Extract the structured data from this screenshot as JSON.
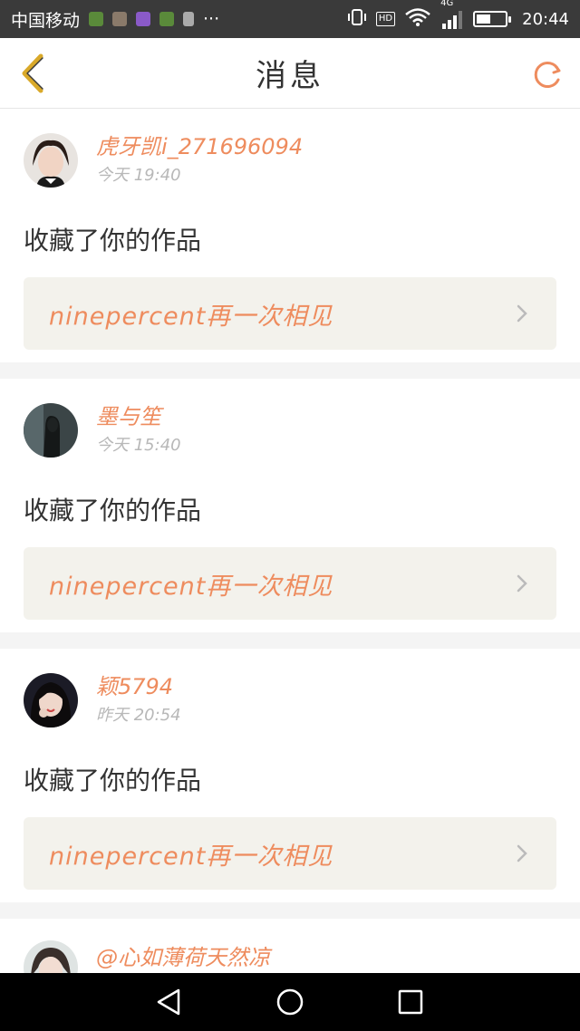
{
  "status_bar": {
    "carrier": "中国移动",
    "more": "···",
    "hd": "HD",
    "network": "4G",
    "time": "20:44",
    "battery_level": 0.5
  },
  "nav": {
    "title": "消息"
  },
  "messages": [
    {
      "username": "虎牙凯i_271696094",
      "time": "今天 19:40",
      "action": "收藏了你的作品",
      "work_title": "ninepercent再一次相见"
    },
    {
      "username": "墨与笙",
      "time": "今天 15:40",
      "action": "收藏了你的作品",
      "work_title": "ninepercent再一次相见"
    },
    {
      "username": "颖5794",
      "time": "昨天 20:54",
      "action": "收藏了你的作品",
      "work_title": "ninepercent再一次相见"
    },
    {
      "username": "@心如薄荷天然凉"
    }
  ],
  "colors": {
    "accent": "#ee8c5e",
    "status_bar": "#3a3a3a",
    "work_bg": "#f3f2ec",
    "back_icon": "#d9a92a"
  }
}
